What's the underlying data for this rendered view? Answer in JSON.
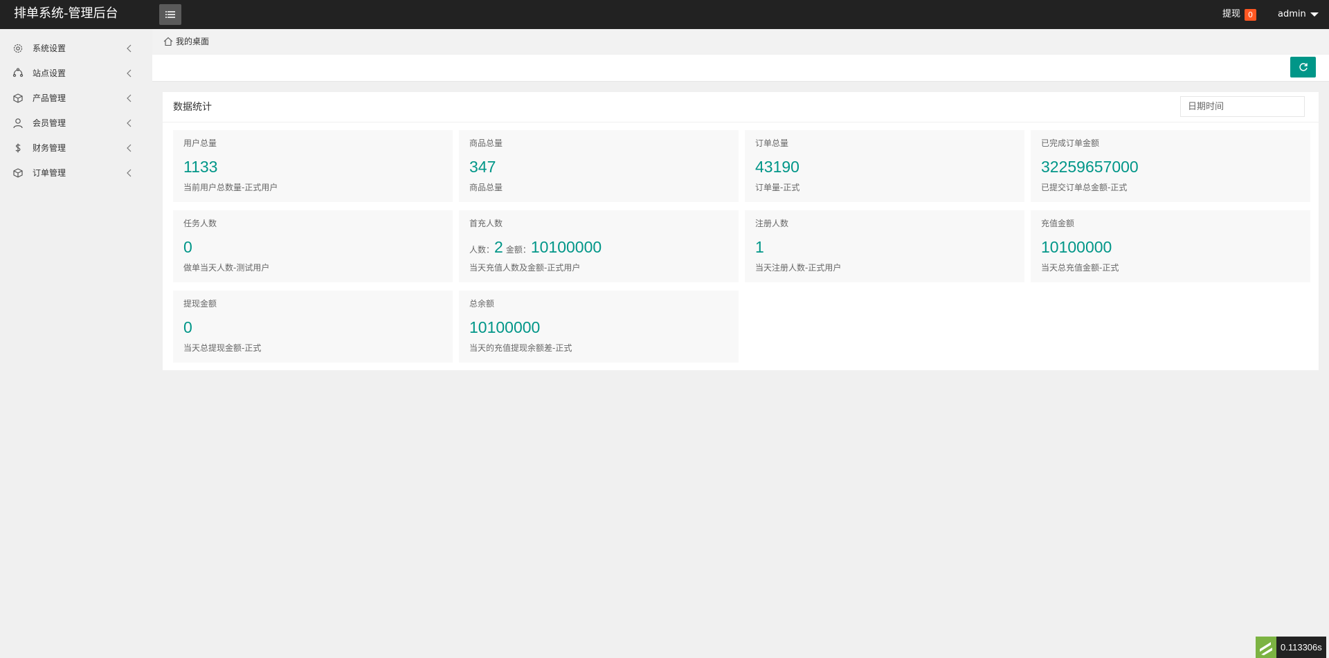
{
  "header": {
    "brand": "排单系统-管理后台",
    "withdraw_label": "提现",
    "withdraw_count": "0",
    "user": "admin"
  },
  "sidebar": {
    "items": [
      {
        "label": "系统设置",
        "icon": "gear-icon"
      },
      {
        "label": "站点设置",
        "icon": "site-icon"
      },
      {
        "label": "产品管理",
        "icon": "box-icon"
      },
      {
        "label": "会员管理",
        "icon": "user-icon"
      },
      {
        "label": "财务管理",
        "icon": "dollar-icon"
      },
      {
        "label": "订单管理",
        "icon": "box-icon"
      }
    ]
  },
  "breadcrumb": {
    "text": "我的桌面"
  },
  "stats": {
    "title": "数据统计",
    "date_placeholder": "日期时间",
    "cards": [
      {
        "title": "用户总量",
        "value": "1133",
        "sub": "当前用户总数量-正式用户"
      },
      {
        "title": "商品总量",
        "value": "347",
        "sub": "商品总量"
      },
      {
        "title": "订单总量",
        "value": "43190",
        "sub": "订单量-正式"
      },
      {
        "title": "已完成订单金额",
        "value": "32259657000",
        "sub": "已提交订单总金额-正式"
      },
      {
        "title": "任务人数",
        "value": "0",
        "sub": "做单当天人数-测试用户"
      },
      {
        "title": "首充人数",
        "people_label": "人数：",
        "people_value": "2",
        "amount_label": "金额：",
        "amount_value": "10100000",
        "sub": "当天充值人数及金额-正式用户"
      },
      {
        "title": "注册人数",
        "value": "1",
        "sub": "当天注册人数-正式用户"
      },
      {
        "title": "充值金额",
        "value": "10100000",
        "sub": "当天总充值金额-正式"
      },
      {
        "title": "提现金额",
        "value": "0",
        "sub": "当天总提现金额-正式"
      },
      {
        "title": "总余额",
        "value": "10100000",
        "sub": "当天的充值提现余额差-正式"
      }
    ]
  },
  "timer": {
    "text": "0.113306s"
  },
  "colors": {
    "accent": "#009688",
    "badge": "#ff5722",
    "header_bg": "#222222"
  }
}
